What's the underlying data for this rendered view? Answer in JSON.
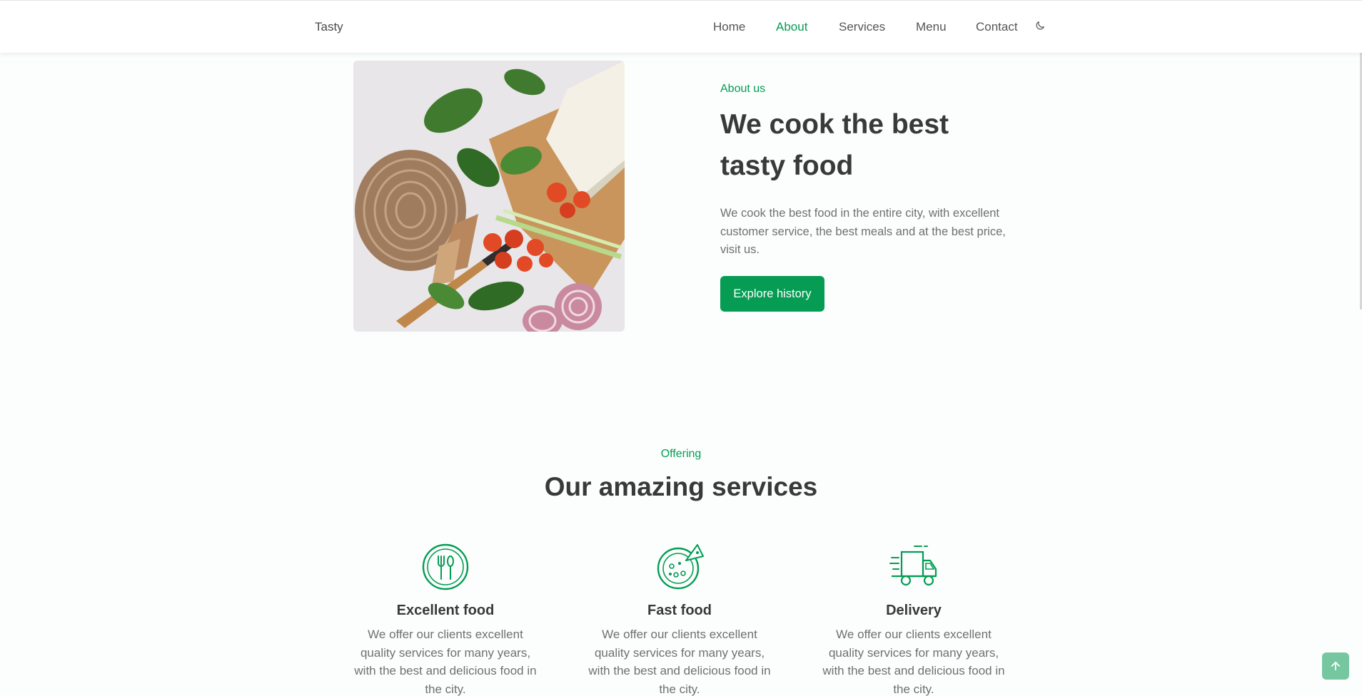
{
  "header": {
    "logo": "Tasty",
    "nav": [
      {
        "label": "Home",
        "active": false
      },
      {
        "label": "About",
        "active": true
      },
      {
        "label": "Services",
        "active": false
      },
      {
        "label": "Menu",
        "active": false
      },
      {
        "label": "Contact",
        "active": false
      }
    ],
    "theme_icon": "moon-icon"
  },
  "about": {
    "subtitle": "About us",
    "title_line1": "We cook the best",
    "title_line2": "tasty food",
    "description": "We cook the best food in the entire city, with excellent customer service, the best meals and at the best price, visit us.",
    "button": "Explore history",
    "image_icon": "food-photo"
  },
  "offering": {
    "subtitle": "Offering",
    "title": "Our amazing services",
    "services": [
      {
        "icon": "restaurant-icon",
        "title": "Excellent food",
        "description": "We offer our clients excellent quality services for many years, with the best and delicious food in the city."
      },
      {
        "icon": "pizza-icon",
        "title": "Fast food",
        "description": "We offer our clients excellent quality services for many years, with the best and delicious food in the city."
      },
      {
        "icon": "delivery-truck-icon",
        "title": "Delivery",
        "description": "We offer our clients excellent quality services for many years, with the best and delicious food in the city."
      }
    ]
  },
  "scroll_top_icon": "arrow-up-icon",
  "colors": {
    "accent": "#069c54",
    "text": "#393939",
    "muted": "#707070",
    "background": "#fbfefd"
  }
}
